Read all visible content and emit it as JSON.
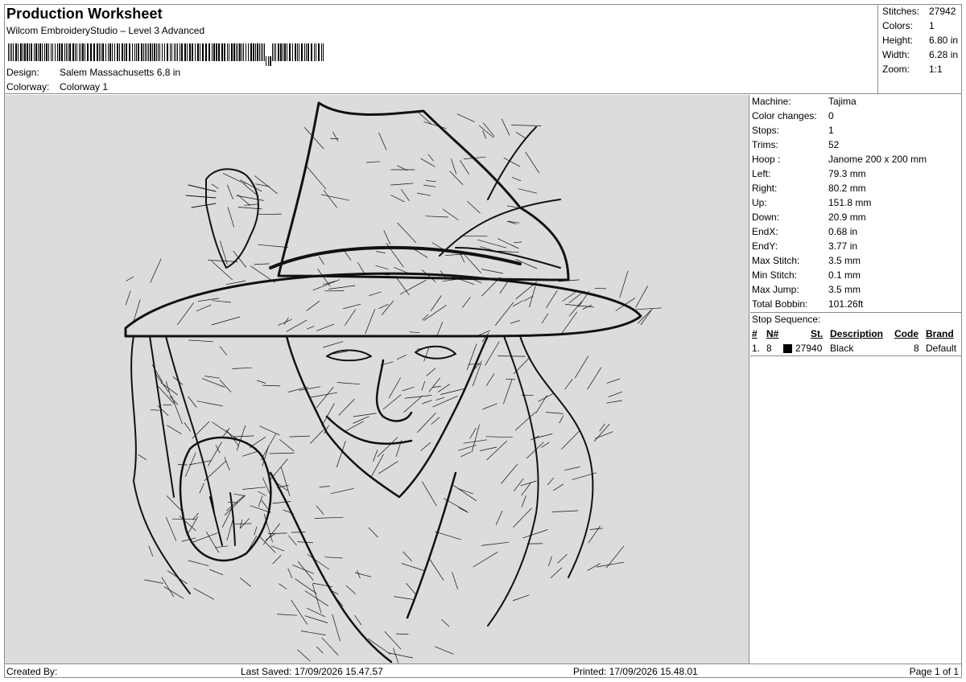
{
  "header": {
    "title": "Production Worksheet",
    "software": "Wilcom EmbroideryStudio – Level 3 Advanced",
    "design_label": "Design:",
    "design_value": "Salem Massachusetts 6,8 in",
    "colorway_label": "Colorway:",
    "colorway_value": "Colorway 1"
  },
  "summary": {
    "stitches_label": "Stitches:",
    "stitches_value": "27942",
    "colors_label": "Colors:",
    "colors_value": "1",
    "height_label": "Height:",
    "height_value": "6.80 in",
    "width_label": "Width:",
    "width_value": "6.28 in",
    "zoom_label": "Zoom:",
    "zoom_value": "1:1"
  },
  "info": {
    "machine_label": "Machine:",
    "machine_value": "Tajima",
    "color_changes_label": "Color changes:",
    "color_changes_value": "0",
    "stops_label": "Stops:",
    "stops_value": "1",
    "trims_label": "Trims:",
    "trims_value": "52",
    "hoop_label": "Hoop :",
    "hoop_value": "Janome 200 x 200 mm",
    "left_label": "Left:",
    "left_value": "79.3 mm",
    "right_label": "Right:",
    "right_value": "80.2 mm",
    "up_label": "Up:",
    "up_value": "151.8 mm",
    "down_label": "Down:",
    "down_value": "20.9 mm",
    "endx_label": "EndX:",
    "endx_value": "0.68 in",
    "endy_label": "EndY:",
    "endy_value": "3.77 in",
    "max_stitch_label": "Max Stitch:",
    "max_stitch_value": "3.5 mm",
    "min_stitch_label": "Min Stitch:",
    "min_stitch_value": "0.1 mm",
    "max_jump_label": "Max Jump:",
    "max_jump_value": "3.5 mm",
    "total_bobbin_label": "Total Bobbin:",
    "total_bobbin_value": "101.26ft"
  },
  "stop_sequence": {
    "label": "Stop Sequence:",
    "headers": {
      "num": "#",
      "n": "N#",
      "st": "St.",
      "description": "Description",
      "code": "Code",
      "brand": "Brand"
    },
    "rows": [
      {
        "num": "1.",
        "n": "8",
        "swatch_color": "#000000",
        "st": "27940",
        "description": "Black",
        "code": "8",
        "brand": "Default"
      }
    ]
  },
  "footer": {
    "created_by": "Created By:",
    "last_saved": "Last Saved: 17/09/2026 15.47.57",
    "printed": "Printed: 17/09/2026 15.48.01",
    "page": "Page 1 of 1"
  },
  "colors": {
    "preview_bg": "#dcdcdc",
    "border": "#8c8c8c",
    "thread": "#111111"
  }
}
